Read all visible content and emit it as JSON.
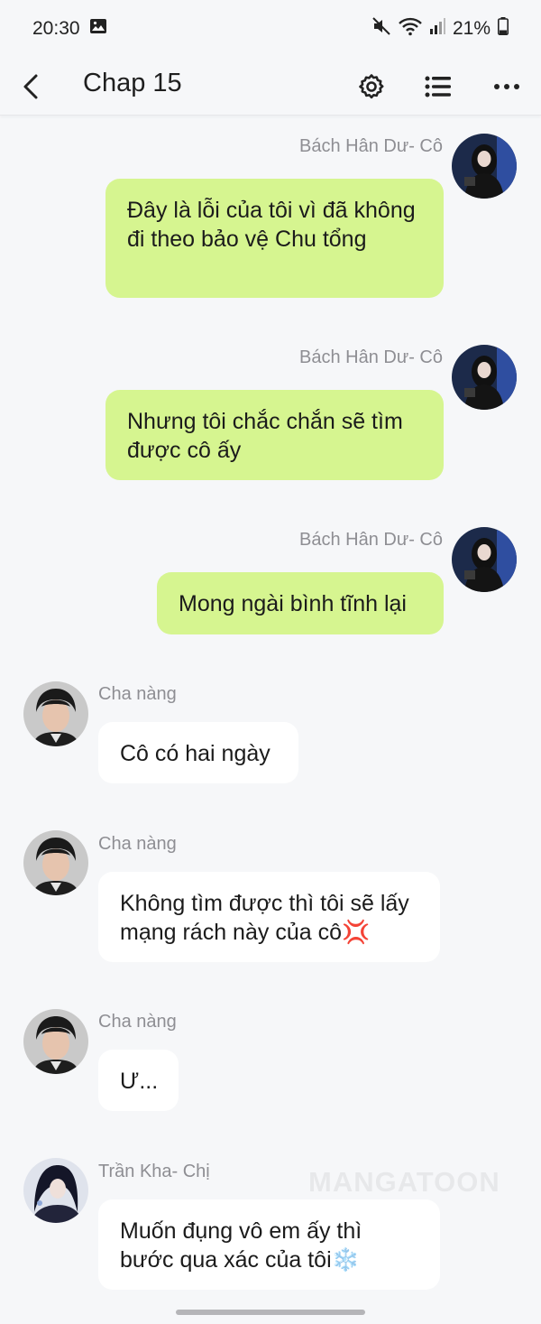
{
  "status_bar": {
    "time": "20:30",
    "battery": "21%",
    "icons": [
      "gallery-icon",
      "mute-icon",
      "wifi-icon",
      "signal-icon",
      "battery-icon"
    ]
  },
  "header": {
    "title": "Chap 15",
    "icons": [
      "back-icon",
      "gear-icon",
      "list-icon",
      "more-icon"
    ]
  },
  "messages": [
    {
      "sender": "Bách Hân Dư- Cô",
      "text": "Đây là lỗi của tôi vì đã không đi theo bảo vệ Chu tổng",
      "side": "right"
    },
    {
      "sender": "Bách Hân Dư- Cô",
      "text": "Nhưng tôi chắc chắn sẽ tìm được cô ấy",
      "side": "right"
    },
    {
      "sender": "Bách Hân Dư- Cô",
      "text": "Mong ngài bình tĩnh lại",
      "side": "right"
    },
    {
      "sender": "Cha nàng",
      "text": "Cô có hai ngày",
      "side": "left"
    },
    {
      "sender": "Cha nàng",
      "text": "Không tìm được thì tôi sẽ lấy mạng rách này của cô💢",
      "side": "left"
    },
    {
      "sender": "Cha nàng",
      "text": "Ư...",
      "side": "left"
    },
    {
      "sender": "Trần Kha- Chị",
      "text": "Muốn đụng vô em ấy thì bước qua xác của tôi❄️",
      "side": "left"
    }
  ],
  "watermark": "MANGATOON",
  "colors": {
    "background": "#f6f7f9",
    "right_bubble": "#d6f590",
    "left_bubble": "#ffffff",
    "sender_name": "#8e8e93"
  }
}
